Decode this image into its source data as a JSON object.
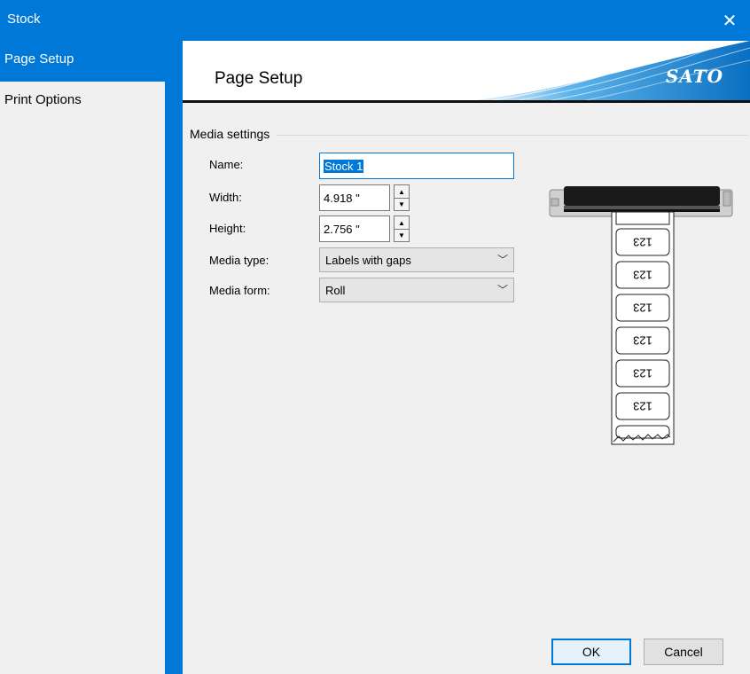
{
  "window": {
    "title": "Stock",
    "close_glyph": "✕"
  },
  "sidebar": {
    "items": [
      {
        "label": "Page Setup",
        "active": true
      },
      {
        "label": "Print Options",
        "active": false
      }
    ]
  },
  "header": {
    "title": "Page Setup",
    "logo": "SATO"
  },
  "media_settings": {
    "group_label": "Media settings",
    "name": {
      "label": "Name:",
      "value": "Stock 1"
    },
    "width": {
      "label": "Width:",
      "value": "4.918 \""
    },
    "height": {
      "label": "Height:",
      "value": "2.756 \""
    },
    "media_type": {
      "label": "Media type:",
      "value": "Labels with gaps"
    },
    "media_form": {
      "label": "Media form:",
      "value": "Roll"
    }
  },
  "preview": {
    "label_text": "123"
  },
  "buttons": {
    "ok": "OK",
    "cancel": "Cancel"
  },
  "icons": {
    "spin_up": "▲",
    "spin_down": "▼",
    "dropdown": "﹀"
  },
  "colors": {
    "accent": "#0078d7",
    "panel": "#f0f0f0"
  }
}
